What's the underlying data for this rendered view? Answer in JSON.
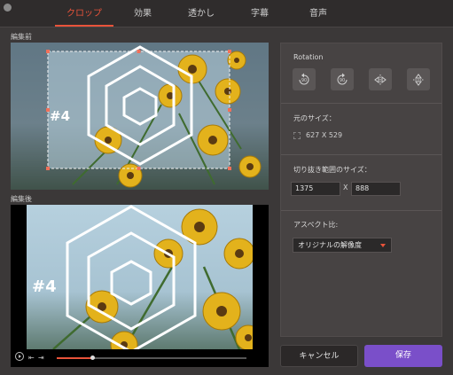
{
  "tabs": [
    {
      "label": "クロップ",
      "active": true
    },
    {
      "label": "効果"
    },
    {
      "label": "透かし"
    },
    {
      "label": "字幕"
    },
    {
      "label": "音声"
    }
  ],
  "before_label": "編集前",
  "after_label": "編集後",
  "watermark_text": "#4",
  "rotation": {
    "title": "Rotation",
    "buttons": [
      {
        "icon": "rotate-left-90-icon",
        "text": "90"
      },
      {
        "icon": "rotate-right-90-icon",
        "text": "90"
      },
      {
        "icon": "flip-horizontal-icon"
      },
      {
        "icon": "flip-vertical-icon"
      }
    ]
  },
  "original_size": {
    "title": "元のサイズ：",
    "value": "627 X 529"
  },
  "crop_size": {
    "title": "切り抜き範囲のサイズ：",
    "width": "1375",
    "x_label": "X",
    "height": "888"
  },
  "aspect": {
    "title": "アスペクト比:",
    "selected": "オリジナルの解像度"
  },
  "player": {
    "progress": 0.19
  },
  "buttons": {
    "cancel": "キャンセル",
    "save": "保存"
  },
  "colors": {
    "accent": "#e9533a",
    "save": "#7a4fc9",
    "handle": "#f0705a"
  }
}
